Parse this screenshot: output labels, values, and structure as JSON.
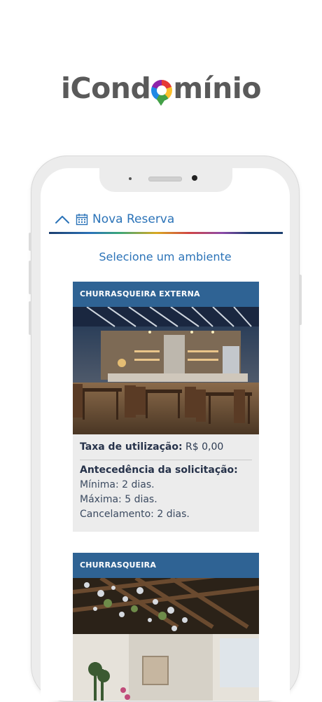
{
  "brand": {
    "prefix": "iCond",
    "suffix": "mínio",
    "colors": [
      "#e53935",
      "#fbc02d",
      "#43a047",
      "#1e88e5",
      "#8e24aa"
    ]
  },
  "header": {
    "title": "Nova Reserva",
    "collapse_icon": "chevron-up-icon",
    "calendar_icon": "calendar-icon"
  },
  "subtitle": "Selecione um ambiente",
  "ambientes": [
    {
      "name": "CHURRASQUEIRA EXTERNA",
      "fee_label": "Taxa de utilização:",
      "fee_value": "R$ 0,00",
      "advance_title": "Antecedência da solicitação:",
      "min": "Mínima: 2 dias.",
      "max": "Máxima: 5 dias.",
      "cancel": "Cancelamento: 2 dias."
    },
    {
      "name": "CHURRASQUEIRA"
    }
  ],
  "colors": {
    "accent": "#2b73b8",
    "card_header": "#2f6394",
    "card_bg": "#ececec"
  }
}
